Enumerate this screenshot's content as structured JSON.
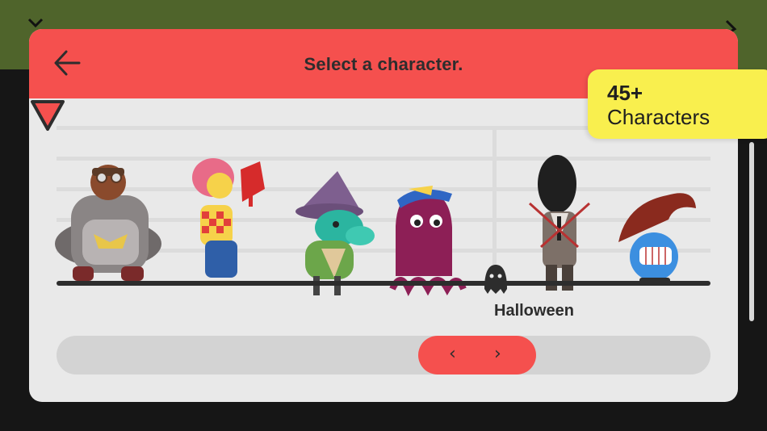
{
  "header": {
    "title": "Select a character."
  },
  "badge": {
    "count": "45+",
    "label": "Characters"
  },
  "lineup": {
    "category_label": "Halloween",
    "characters": [
      {
        "name": "armored-warrior"
      },
      {
        "name": "sports-fan-girl"
      },
      {
        "name": "goat-witch"
      },
      {
        "name": "purple-octopus"
      },
      {
        "name": "shadow-man"
      },
      {
        "name": "blue-troll"
      }
    ],
    "selected_index": 2
  },
  "scroller": {
    "prev_label": "‹",
    "next_label": "›"
  },
  "colors": {
    "accent": "#f5504e",
    "badge": "#f9ef4e",
    "background_top": "#4f642b",
    "panel": "#e9e9e9"
  }
}
